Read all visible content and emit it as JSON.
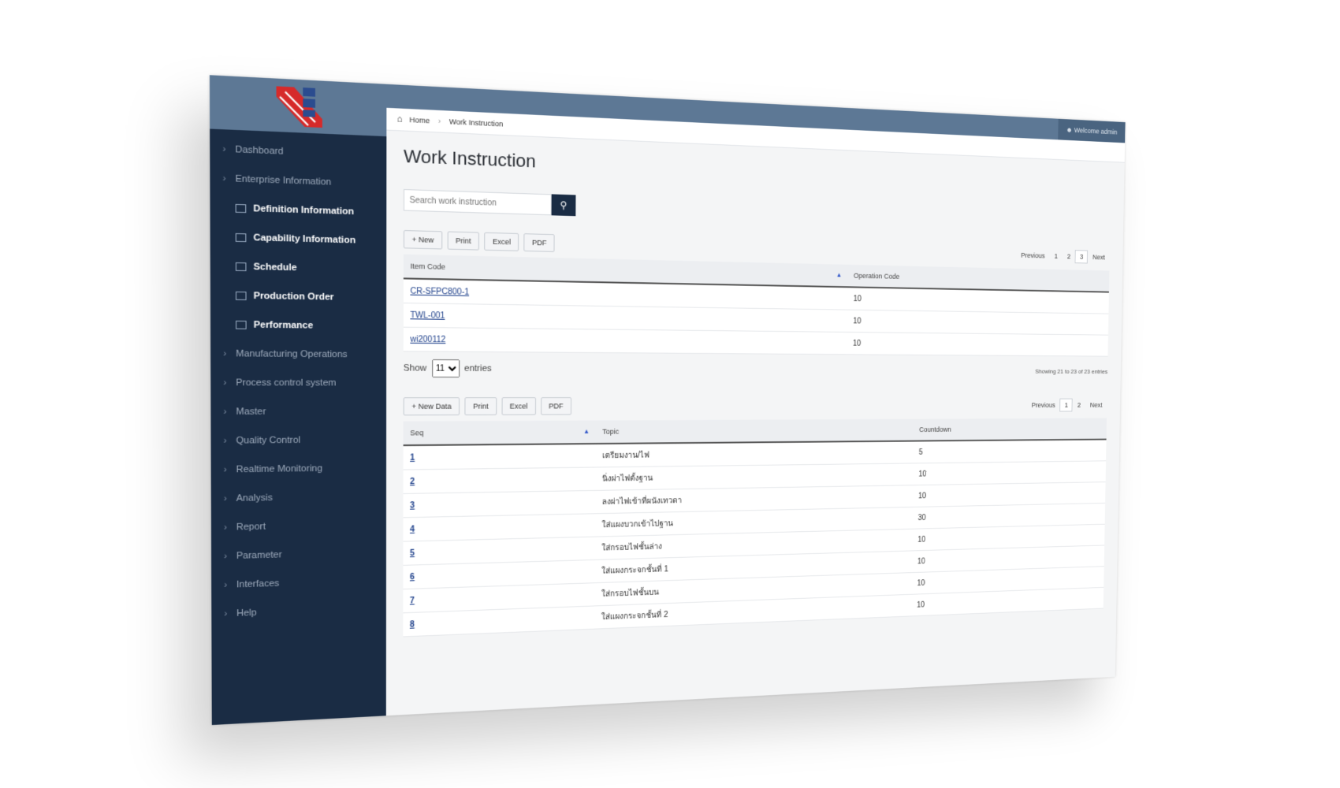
{
  "topbar": {
    "user": "Welcome admin"
  },
  "breadcrumb": {
    "home": "Home",
    "current": "Work Instruction"
  },
  "sidebar": {
    "items": [
      {
        "label": "Dashboard",
        "type": "group"
      },
      {
        "label": "Enterprise Information",
        "type": "group"
      },
      {
        "label": "Definition Information",
        "type": "sub"
      },
      {
        "label": "Capability Information",
        "type": "sub"
      },
      {
        "label": "Schedule",
        "type": "sub"
      },
      {
        "label": "Production Order",
        "type": "sub"
      },
      {
        "label": "Performance",
        "type": "sub"
      },
      {
        "label": "Manufacturing Operations",
        "type": "group"
      },
      {
        "label": "Process control system",
        "type": "group"
      },
      {
        "label": "Master",
        "type": "group"
      },
      {
        "label": "Quality Control",
        "type": "group"
      },
      {
        "label": "Realtime Monitoring",
        "type": "group"
      },
      {
        "label": "Analysis",
        "type": "group"
      },
      {
        "label": "Report",
        "type": "group"
      },
      {
        "label": "Parameter",
        "type": "group"
      },
      {
        "label": "Interfaces",
        "type": "group"
      },
      {
        "label": "Help",
        "type": "group"
      }
    ]
  },
  "page": {
    "title": "Work Instruction"
  },
  "search": {
    "placeholder": "Search work instruction"
  },
  "table1": {
    "buttons": {
      "new": "+ New",
      "print": "Print",
      "excel": "Excel",
      "pdf": "PDF"
    },
    "pager": {
      "previous": "Previous",
      "pages": [
        "1",
        "2",
        "3"
      ],
      "active": "3",
      "next": "Next"
    },
    "headers": {
      "item_code": "Item Code",
      "operation_code": "Operation Code"
    },
    "rows": [
      {
        "item_code": "CR-SFPC800-1",
        "operation_code": "10"
      },
      {
        "item_code": "TWL-001",
        "operation_code": "10"
      },
      {
        "item_code": "wi200112",
        "operation_code": "10"
      }
    ],
    "show": {
      "label": "Show",
      "value": "11",
      "suffix": "entries"
    },
    "info": "Showing 21 to 23 of 23 entries"
  },
  "table2": {
    "buttons": {
      "new": "+ New Data",
      "print": "Print",
      "excel": "Excel",
      "pdf": "PDF"
    },
    "pager": {
      "previous": "Previous",
      "pages": [
        "1",
        "2"
      ],
      "active": "1",
      "next": "Next"
    },
    "headers": {
      "seq": "Seq",
      "topic": "Topic",
      "countdown": "Countdown"
    },
    "rows": [
      {
        "seq": "1",
        "topic": "เตรียมงาน/ไฟ",
        "countdown": "5"
      },
      {
        "seq": "2",
        "topic": "นิ่งผ่าไฟตั้งฐาน",
        "countdown": "10"
      },
      {
        "seq": "3",
        "topic": "ลงผ่าไฟเข้าที่ผนังเทวดา",
        "countdown": "10"
      },
      {
        "seq": "4",
        "topic": "ใส่แผงบวกเข้าไปฐาน",
        "countdown": "30"
      },
      {
        "seq": "5",
        "topic": "ใส่กรอบไฟชั้นล่าง",
        "countdown": "10"
      },
      {
        "seq": "6",
        "topic": "ใส่แผงกระจกชั้นที่ 1",
        "countdown": "10"
      },
      {
        "seq": "7",
        "topic": "ใส่กรอบไฟชั้นบน",
        "countdown": "10"
      },
      {
        "seq": "8",
        "topic": "ใส่แผงกระจกชั้นที่ 2",
        "countdown": "10"
      }
    ]
  }
}
